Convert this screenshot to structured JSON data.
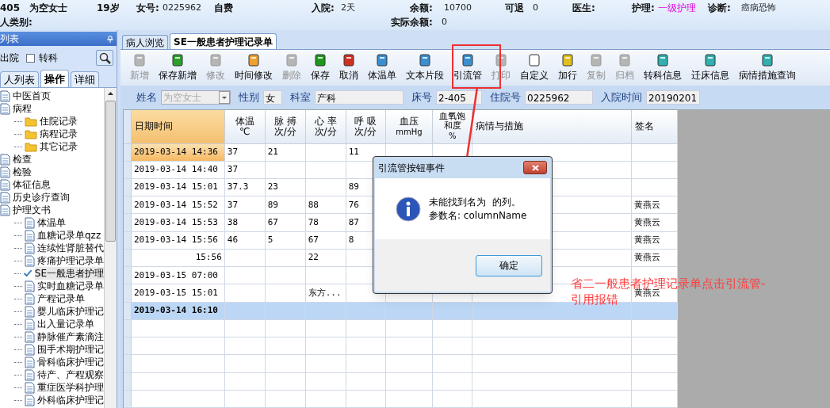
{
  "header": {
    "row1": [
      {
        "text": "405",
        "kind": "bold"
      },
      {
        "text": "为空女士",
        "kind": "bold"
      },
      {
        "text": "19岁",
        "kind": "bold"
      },
      {
        "text": "女号:",
        "kind": "bold"
      },
      {
        "text": "0225962",
        "kind": "value"
      },
      {
        "text": "自费",
        "kind": "bold"
      },
      {
        "text": "入院:",
        "kind": "bold"
      },
      {
        "text": "2天",
        "kind": "value"
      },
      {
        "text": "余额:",
        "kind": "bold"
      },
      {
        "text": "10700",
        "kind": "value"
      },
      {
        "text": "可退",
        "kind": "bold"
      },
      {
        "text": "0",
        "kind": "value"
      },
      {
        "text": "医生:",
        "kind": "bold"
      },
      {
        "text": "护理:",
        "kind": "bold"
      },
      {
        "text": "一级护理",
        "kind": "highlight"
      },
      {
        "text": "诊断:",
        "kind": "bold"
      },
      {
        "text": "癌病恐怖",
        "kind": "value"
      }
    ],
    "row2": [
      {
        "text": "人类别:",
        "kind": "bold"
      },
      {
        "text": "实际余额:",
        "kind": "bold"
      },
      {
        "text": "0",
        "kind": "value"
      }
    ]
  },
  "left_panel": {
    "title": "列表",
    "discharged_label": "出院",
    "transfer": {
      "label": "转科",
      "checked": false
    },
    "tabs": [
      {
        "label": "人列表",
        "selected": false
      },
      {
        "label": "操作",
        "selected": true
      },
      {
        "label": "详细",
        "selected": false
      }
    ],
    "tree": [
      {
        "label": "中医首页",
        "selected": false
      },
      {
        "label": "病程",
        "selected": false,
        "children": [
          {
            "label": "住院记录",
            "selected": false
          },
          {
            "label": "病程记录",
            "selected": false
          },
          {
            "label": "其它记录",
            "selected": false
          }
        ]
      },
      {
        "label": "检查",
        "selected": false
      },
      {
        "label": "检验",
        "selected": false
      },
      {
        "label": "体征信息",
        "selected": false
      },
      {
        "label": "历史诊疗查询",
        "selected": false
      },
      {
        "label": "护理文书",
        "selected": false,
        "children": [
          {
            "label": "体温单",
            "selected": false
          },
          {
            "label": "血糖记录单qzz",
            "selected": false
          },
          {
            "label": "连续性肾脏替代",
            "selected": false
          },
          {
            "label": "疼痛护理记录单",
            "selected": false
          },
          {
            "label": "SE一般患者护理",
            "selected": true
          },
          {
            "label": "实时血糖记录单",
            "selected": false
          },
          {
            "label": "产程记录单",
            "selected": false
          },
          {
            "label": "婴儿临床护理记",
            "selected": false
          },
          {
            "label": "出入量记录单",
            "selected": false
          },
          {
            "label": "静脉催产素滴注",
            "selected": false
          },
          {
            "label": "围手术期护理记",
            "selected": false
          },
          {
            "label": "骨科临床护理记",
            "selected": false
          },
          {
            "label": "待产、产程观察",
            "selected": false
          },
          {
            "label": "重症医学科护理",
            "selected": false
          },
          {
            "label": "外科临床护理记",
            "selected": false
          }
        ]
      }
    ]
  },
  "tabs": [
    {
      "label": "病人浏览",
      "selected": false
    },
    {
      "label": "SE一般患者护理记录单",
      "selected": true
    }
  ],
  "toolbar": [
    {
      "label": "新增",
      "disabled": true
    },
    {
      "label": "保存新增",
      "disabled": false
    },
    {
      "label": "修改",
      "disabled": true
    },
    {
      "label": "时间修改",
      "disabled": false
    },
    {
      "label": "删除",
      "disabled": true
    },
    {
      "label": "保存",
      "disabled": false
    },
    {
      "label": "取消",
      "disabled": false
    },
    {
      "label": "体温单",
      "disabled": false
    },
    {
      "label": "文本片段",
      "disabled": false
    },
    {
      "label": "引流管",
      "disabled": false
    },
    {
      "label": "打印",
      "disabled": true
    },
    {
      "label": "自定义",
      "disabled": false
    },
    {
      "label": "加行",
      "disabled": false
    },
    {
      "label": "复制",
      "disabled": true
    },
    {
      "label": "归档",
      "disabled": true
    },
    {
      "label": "转科信息",
      "disabled": false
    },
    {
      "label": "迁床信息",
      "disabled": false
    },
    {
      "label": "病情措施查询",
      "disabled": false
    }
  ],
  "patient": [
    {
      "label": "姓名",
      "value": "为空女士",
      "kind": "combo"
    },
    {
      "label": "性别",
      "value": "女",
      "kind": "text"
    },
    {
      "label": "科室",
      "value": "产科",
      "kind": "text"
    },
    {
      "label": "床号",
      "value": "2-405",
      "kind": "text"
    },
    {
      "label": "住院号",
      "value": "0225962",
      "kind": "text"
    },
    {
      "label": "入院时间",
      "value": "20190201",
      "kind": "text"
    }
  ],
  "table": {
    "columns": [
      {
        "label": "日期时间"
      },
      {
        "label": "体温",
        "unit": "℃"
      },
      {
        "label": "脉 搏",
        "unit": "次/分"
      },
      {
        "label": "心 率",
        "unit": "次/分"
      },
      {
        "label": "呼 吸",
        "unit": "次/分"
      },
      {
        "label": "血压",
        "unit": "mmHg"
      },
      {
        "label": "血氧饱和度",
        "unit": "%"
      },
      {
        "label": "病情与措施"
      },
      {
        "label": "签名"
      }
    ],
    "rows": [
      {
        "kind": "record",
        "selected": true,
        "cells": [
          "2019-03-14 14:36",
          "37",
          "21",
          "",
          "11",
          "",
          "",
          "",
          ""
        ]
      },
      {
        "kind": "record",
        "selected": false,
        "cells": [
          "2019-03-14 14:40",
          "37",
          "",
          "",
          "",
          "",
          "",
          "",
          ""
        ]
      },
      {
        "kind": "record",
        "selected": false,
        "cells": [
          "2019-03-14 15:01",
          "37.3",
          "23",
          "",
          "89",
          "",
          "",
          "",
          ""
        ]
      },
      {
        "kind": "record",
        "selected": false,
        "cells": [
          "2019-03-14 15:52",
          "37",
          "89",
          "88",
          "76",
          "",
          "",
          "",
          "黄燕云"
        ]
      },
      {
        "kind": "record",
        "selected": false,
        "cells": [
          "2019-03-14 15:53",
          "38",
          "67",
          "78",
          "87",
          "",
          "",
          "",
          "黄燕云"
        ]
      },
      {
        "kind": "record",
        "selected": false,
        "cells": [
          "2019-03-14 15:56",
          "46",
          "5",
          "67",
          "8",
          "",
          "",
          "",
          "黄燕云"
        ]
      },
      {
        "kind": "time_only",
        "selected": false,
        "cells": [
          "15:56",
          "",
          "",
          "22",
          "",
          "",
          "",
          "",
          "黄燕云"
        ]
      },
      {
        "kind": "record",
        "selected": false,
        "cells": [
          "2019-03-15 07:00",
          "",
          "",
          "",
          "",
          "",
          "",
          "",
          ""
        ]
      },
      {
        "kind": "record",
        "selected": false,
        "cells": [
          "2019-03-15 15:01",
          "",
          "",
          "东方...",
          "",
          "",
          "",
          "",
          "黄燕云"
        ]
      },
      {
        "kind": "summary",
        "selected": false,
        "cells": [
          "2019-03-14 16:10",
          "",
          "",
          "",
          "",
          "",
          "",
          "",
          ""
        ]
      }
    ]
  },
  "dialog": {
    "title": "引流管按钮事件",
    "lines": [
      "未能找到名为  的列。",
      "参数名: columnName"
    ],
    "button": "确定"
  },
  "annotation": {
    "lines": [
      "省二一般患者护理记录单点击引流管-",
      "引用报错"
    ]
  }
}
